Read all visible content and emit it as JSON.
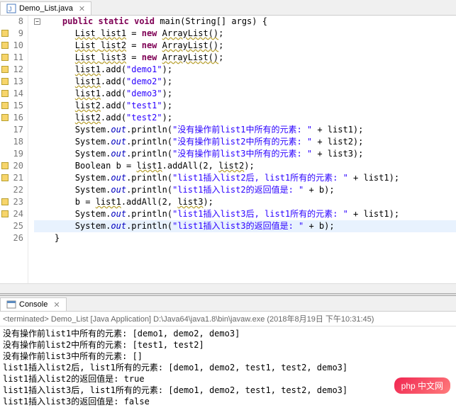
{
  "tab": {
    "filename": "Demo_List.java"
  },
  "gutter": {
    "lines": [
      8,
      9,
      10,
      11,
      12,
      13,
      14,
      15,
      16,
      17,
      18,
      19,
      20,
      21,
      22,
      23,
      24,
      25,
      26
    ],
    "warnings": [
      9,
      10,
      11,
      12,
      13,
      14,
      15,
      16,
      20,
      21,
      23,
      24
    ]
  },
  "code": {
    "lines": [
      {
        "n": 8,
        "indent": 1,
        "tokens": [
          {
            "t": "public",
            "c": "kw"
          },
          {
            "t": " "
          },
          {
            "t": "static",
            "c": "kw"
          },
          {
            "t": " "
          },
          {
            "t": "void",
            "c": "kw"
          },
          {
            "t": " main(String[] args) {"
          }
        ],
        "collapse": true
      },
      {
        "n": 9,
        "indent": 2,
        "tokens": [
          {
            "t": "List ",
            "c": "warn-underline"
          },
          {
            "t": "list1",
            "c": "warn-underline"
          },
          {
            "t": " = "
          },
          {
            "t": "new",
            "c": "kw"
          },
          {
            "t": " "
          },
          {
            "t": "ArrayList()",
            "c": "warn-underline"
          },
          {
            "t": ";"
          }
        ]
      },
      {
        "n": 10,
        "indent": 2,
        "tokens": [
          {
            "t": "List ",
            "c": "warn-underline"
          },
          {
            "t": "list2",
            "c": "warn-underline"
          },
          {
            "t": " = "
          },
          {
            "t": "new",
            "c": "kw"
          },
          {
            "t": " "
          },
          {
            "t": "ArrayList()",
            "c": "warn-underline"
          },
          {
            "t": ";"
          }
        ]
      },
      {
        "n": 11,
        "indent": 2,
        "tokens": [
          {
            "t": "List ",
            "c": "warn-underline"
          },
          {
            "t": "list3",
            "c": "warn-underline"
          },
          {
            "t": " = "
          },
          {
            "t": "new",
            "c": "kw"
          },
          {
            "t": " "
          },
          {
            "t": "ArrayList()",
            "c": "warn-underline"
          },
          {
            "t": ";"
          }
        ]
      },
      {
        "n": 12,
        "indent": 2,
        "tokens": [
          {
            "t": "list1",
            "c": "warn-underline"
          },
          {
            "t": ".add("
          },
          {
            "t": "\"demo1\"",
            "c": "str"
          },
          {
            "t": ");"
          }
        ]
      },
      {
        "n": 13,
        "indent": 2,
        "tokens": [
          {
            "t": "list1",
            "c": "warn-underline"
          },
          {
            "t": ".add("
          },
          {
            "t": "\"demo2\"",
            "c": "str"
          },
          {
            "t": ");"
          }
        ]
      },
      {
        "n": 14,
        "indent": 2,
        "tokens": [
          {
            "t": "list1",
            "c": "warn-underline"
          },
          {
            "t": ".add("
          },
          {
            "t": "\"demo3\"",
            "c": "str"
          },
          {
            "t": ");"
          }
        ]
      },
      {
        "n": 15,
        "indent": 2,
        "tokens": [
          {
            "t": "list2",
            "c": "warn-underline"
          },
          {
            "t": ".add("
          },
          {
            "t": "\"test1\"",
            "c": "str"
          },
          {
            "t": ");"
          }
        ]
      },
      {
        "n": 16,
        "indent": 2,
        "tokens": [
          {
            "t": "list2",
            "c": "warn-underline"
          },
          {
            "t": ".add("
          },
          {
            "t": "\"test2\"",
            "c": "str"
          },
          {
            "t": ");"
          }
        ]
      },
      {
        "n": 17,
        "indent": 2,
        "tokens": [
          {
            "t": "System."
          },
          {
            "t": "out",
            "c": "field"
          },
          {
            "t": ".println("
          },
          {
            "t": "\"没有操作前list1中所有的元素: \"",
            "c": "str"
          },
          {
            "t": " + list1);"
          }
        ]
      },
      {
        "n": 18,
        "indent": 2,
        "tokens": [
          {
            "t": "System."
          },
          {
            "t": "out",
            "c": "field"
          },
          {
            "t": ".println("
          },
          {
            "t": "\"没有操作前list2中所有的元素: \"",
            "c": "str"
          },
          {
            "t": " + list2);"
          }
        ]
      },
      {
        "n": 19,
        "indent": 2,
        "tokens": [
          {
            "t": "System."
          },
          {
            "t": "out",
            "c": "field"
          },
          {
            "t": ".println("
          },
          {
            "t": "\"没有操作前list3中所有的元素: \"",
            "c": "str"
          },
          {
            "t": " + list3);"
          }
        ]
      },
      {
        "n": 20,
        "indent": 2,
        "tokens": [
          {
            "t": "Boolean b = "
          },
          {
            "t": "list1",
            "c": "warn-underline"
          },
          {
            "t": ".addAll(2, "
          },
          {
            "t": "list2",
            "c": "warn-underline"
          },
          {
            "t": ");"
          }
        ]
      },
      {
        "n": 21,
        "indent": 2,
        "tokens": [
          {
            "t": "System."
          },
          {
            "t": "out",
            "c": "field"
          },
          {
            "t": ".println("
          },
          {
            "t": "\"list1插入list2后, list1所有的元素: \"",
            "c": "str"
          },
          {
            "t": " + list1);"
          }
        ]
      },
      {
        "n": 22,
        "indent": 2,
        "tokens": [
          {
            "t": "System."
          },
          {
            "t": "out",
            "c": "field"
          },
          {
            "t": ".println("
          },
          {
            "t": "\"list1插入list2的返回值是: \"",
            "c": "str"
          },
          {
            "t": " + b);"
          }
        ]
      },
      {
        "n": 23,
        "indent": 2,
        "tokens": [
          {
            "t": "b = "
          },
          {
            "t": "list1",
            "c": "warn-underline"
          },
          {
            "t": ".addAll(2, "
          },
          {
            "t": "list3",
            "c": "warn-underline"
          },
          {
            "t": ");"
          }
        ]
      },
      {
        "n": 24,
        "indent": 2,
        "tokens": [
          {
            "t": "System."
          },
          {
            "t": "out",
            "c": "field"
          },
          {
            "t": ".println("
          },
          {
            "t": "\"list1插入list3后, list1所有的元素: \"",
            "c": "str"
          },
          {
            "t": " + list1);"
          }
        ]
      },
      {
        "n": 25,
        "indent": 2,
        "tokens": [
          {
            "t": "System."
          },
          {
            "t": "out",
            "c": "field"
          },
          {
            "t": ".println("
          },
          {
            "t": "\"list1插入list3的返回值是: \"",
            "c": "str"
          },
          {
            "t": " + b);"
          }
        ],
        "hl": true
      },
      {
        "n": 26,
        "indent": 1,
        "tokens": [
          {
            "t": "}"
          }
        ]
      }
    ]
  },
  "console": {
    "tab_label": "Console",
    "terminated": "<terminated> Demo_List [Java Application] D:\\Java64\\java1.8\\bin\\javaw.exe (2018年8月19日 下午10:31:45)",
    "output": [
      "没有操作前list1中所有的元素: [demo1, demo2, demo3]",
      "没有操作前list2中所有的元素: [test1, test2]",
      "没有操作前list3中所有的元素: []",
      "list1插入list2后, list1所有的元素: [demo1, demo2, test1, test2, demo3]",
      "list1插入list2的返回值是: true",
      "list1插入list3后, list1所有的元素: [demo1, demo2, test1, test2, demo3]",
      "list1插入list3的返回值是: false"
    ]
  },
  "watermark": "php 中文网"
}
